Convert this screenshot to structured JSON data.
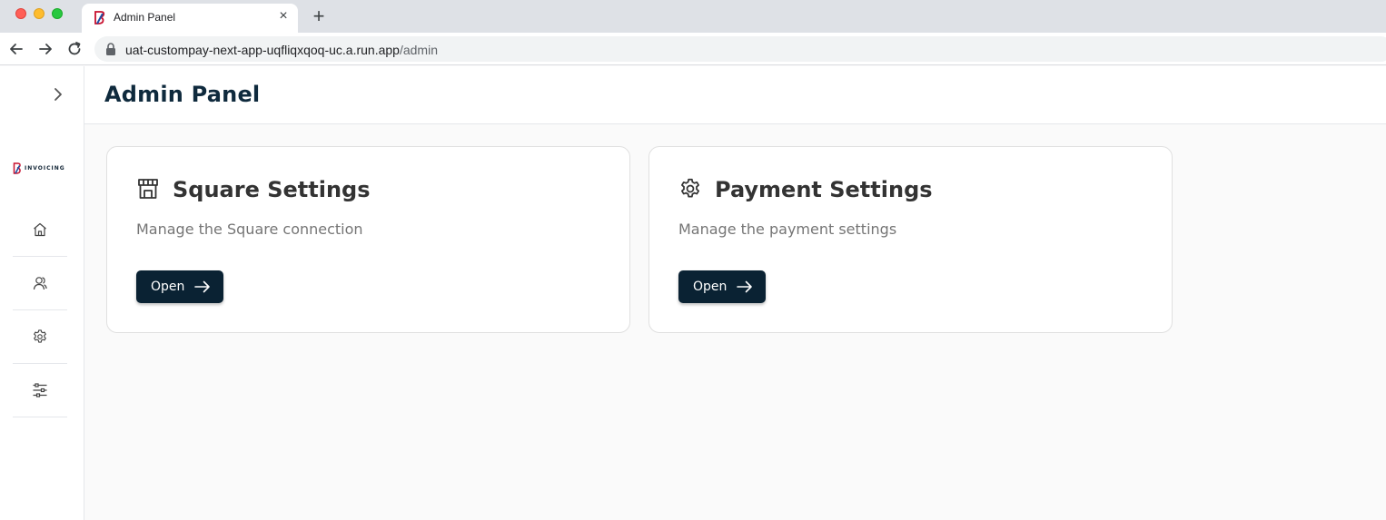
{
  "browser": {
    "tab_title": "Admin Panel",
    "tab_close": "×",
    "new_tab": "+",
    "url_host": "uat-custompay-next-app-uqfliqxqoq-uc.a.run.app",
    "url_path": "/admin"
  },
  "sidebar": {
    "logo_text": "INVOICING",
    "items": [
      {
        "name": "home",
        "icon": "home-icon"
      },
      {
        "name": "users",
        "icon": "users-icon"
      },
      {
        "name": "settings",
        "icon": "gear-icon"
      },
      {
        "name": "admin",
        "icon": "sliders-icon"
      }
    ]
  },
  "header": {
    "title": "Admin Panel"
  },
  "cards": [
    {
      "icon": "store-icon",
      "title": "Square Settings",
      "description": "Manage the Square connection",
      "button_label": "Open"
    },
    {
      "icon": "gear-icon",
      "title": "Payment Settings",
      "description": "Manage the payment settings",
      "button_label": "Open"
    }
  ],
  "colors": {
    "primary_button": "#0a2233",
    "title": "#0f2a3d",
    "logo_accent": "#c8102e"
  }
}
